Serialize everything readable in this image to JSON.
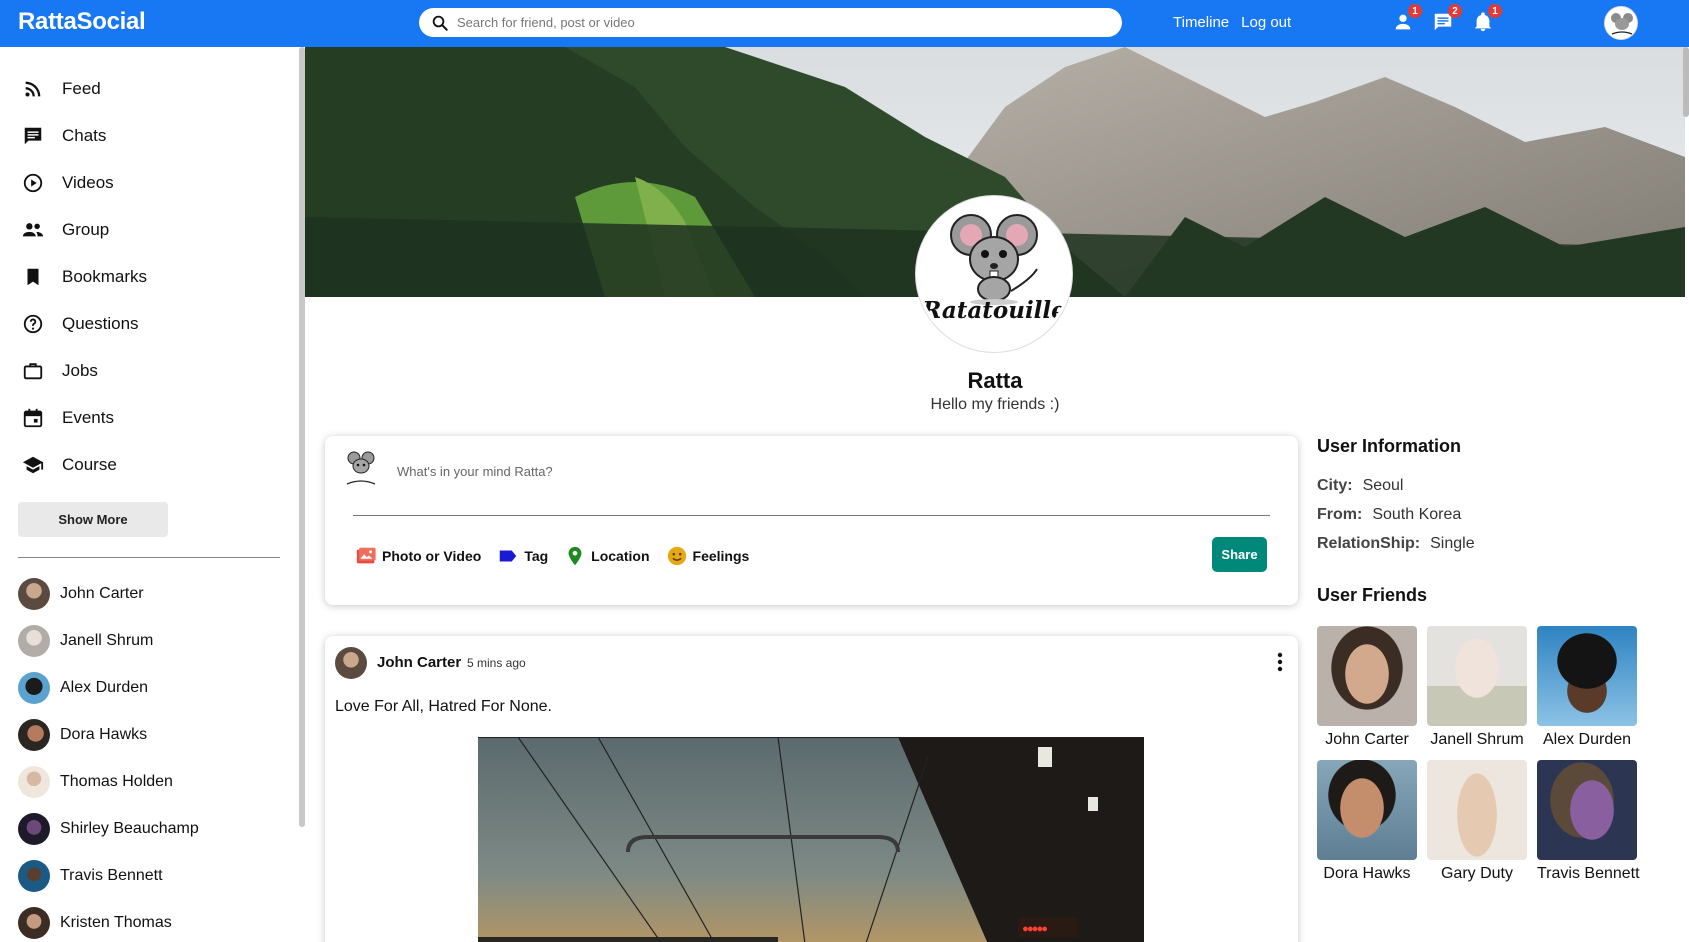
{
  "app": {
    "title": "RattaSocial"
  },
  "search": {
    "placeholder": "Search for friend, post or video"
  },
  "topbar": {
    "links": [
      "Timeline",
      "Log out"
    ],
    "icons": [
      {
        "name": "person-icon",
        "badge": "1"
      },
      {
        "name": "chat-icon",
        "badge": "2"
      },
      {
        "name": "notifications-icon",
        "badge": "1"
      }
    ]
  },
  "sidebar": {
    "menu": [
      {
        "label": "Feed",
        "icon": "rss-feed-icon"
      },
      {
        "label": "Chats",
        "icon": "chat-icon"
      },
      {
        "label": "Videos",
        "icon": "play-circle-icon"
      },
      {
        "label": "Group",
        "icon": "group-icon"
      },
      {
        "label": "Bookmarks",
        "icon": "bookmark-icon"
      },
      {
        "label": "Questions",
        "icon": "help-circle-icon"
      },
      {
        "label": "Jobs",
        "icon": "work-icon"
      },
      {
        "label": "Events",
        "icon": "event-icon"
      },
      {
        "label": "Course",
        "icon": "school-icon"
      }
    ],
    "show_more": "Show More",
    "friends": [
      {
        "name": "John Carter",
        "color": "#8d7d72"
      },
      {
        "name": "Janell Shrum",
        "color": "#c9c4bf"
      },
      {
        "name": "Alex Durden",
        "color": "#3a6d8c"
      },
      {
        "name": "Dora Hawks",
        "color": "#a8755c"
      },
      {
        "name": "Thomas Holden",
        "color": "#e3d4c6"
      },
      {
        "name": "Shirley Beauchamp",
        "color": "#3d3350"
      },
      {
        "name": "Travis Bennett",
        "color": "#1d4f6e"
      },
      {
        "name": "Kristen Thomas",
        "color": "#7a5c4a"
      }
    ]
  },
  "profile": {
    "logo_text": "Ratatouille",
    "name": "Ratta",
    "bio": "Hello my friends :)"
  },
  "share": {
    "placeholder": "What's in your mind Ratta?",
    "options": [
      {
        "label": "Photo or Video",
        "icon": "photo-icon",
        "color": "#e74c3c"
      },
      {
        "label": "Tag",
        "icon": "label-icon",
        "color": "#1a1ad6"
      },
      {
        "label": "Location",
        "icon": "location-pin-icon",
        "color": "#1e8a1e"
      },
      {
        "label": "Feelings",
        "icon": "emoji-icon",
        "color": "#e6a817"
      }
    ],
    "button": "Share"
  },
  "post": {
    "author": "John Carter",
    "time": "5 mins ago",
    "text": "Love For All, Hatred For None."
  },
  "user_info": {
    "title": "User Information",
    "rows": [
      {
        "label": "City:",
        "value": "Seoul"
      },
      {
        "label": "From:",
        "value": "South Korea"
      },
      {
        "label": "RelationShip:",
        "value": "Single"
      }
    ]
  },
  "user_friends": {
    "title": "User Friends",
    "items": [
      {
        "name": "John Carter",
        "color": "#9a8678"
      },
      {
        "name": "Janell Shrum",
        "color": "#d8d6d2"
      },
      {
        "name": "Alex Durden",
        "color": "#4f8fb5"
      },
      {
        "name": "Dora Hawks",
        "color": "#6f8fa3"
      },
      {
        "name": "Gary Duty",
        "color": "#ddd1c4"
      },
      {
        "name": "Travis Bennett",
        "color": "#3a4a66"
      }
    ]
  },
  "colors": {
    "brand": "#1877f2",
    "share_button": "#00897b",
    "badge": "#e53935"
  }
}
